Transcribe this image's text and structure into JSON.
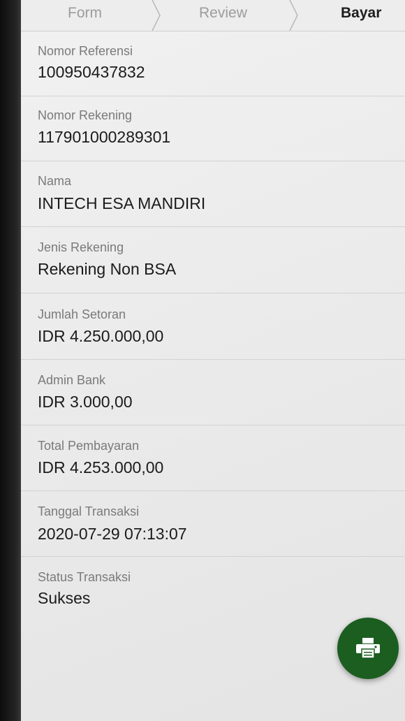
{
  "stepper": {
    "steps": [
      {
        "label": "Form",
        "state": "done"
      },
      {
        "label": "Review",
        "state": "done"
      },
      {
        "label": "Bayar",
        "state": "active"
      }
    ]
  },
  "details": [
    {
      "label": "Nomor Referensi",
      "value": "100950437832"
    },
    {
      "label": "Nomor Rekening",
      "value": "117901000289301"
    },
    {
      "label": "Nama",
      "value": "INTECH ESA MANDIRI"
    },
    {
      "label": "Jenis Rekening",
      "value": "Rekening Non BSA"
    },
    {
      "label": "Jumlah Setoran",
      "value": "IDR 4.250.000,00"
    },
    {
      "label": "Admin Bank",
      "value": "IDR 3.000,00"
    },
    {
      "label": "Total Pembayaran",
      "value": "IDR 4.253.000,00"
    },
    {
      "label": "Tanggal Transaksi",
      "value": "2020-07-29 07:13:07"
    },
    {
      "label": "Status Transaksi",
      "value": "Sukses"
    }
  ],
  "fab": {
    "icon": "printer-icon",
    "color": "#1b5e20"
  }
}
